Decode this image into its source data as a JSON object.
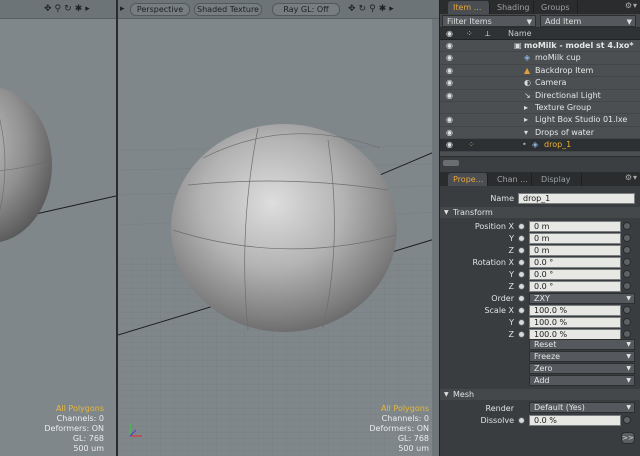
{
  "viewport_left": {
    "icons": [
      "move-icon",
      "zoom-icon",
      "rotate-icon",
      "settings-icon",
      "menu-arrow-icon"
    ],
    "info": {
      "selection_mode": "All Polygons",
      "channels": "Channels: 0",
      "deformers": "Deformers: ON",
      "gl": "GL: 768",
      "units": "500 um"
    }
  },
  "viewport_main": {
    "view_label": "Perspective",
    "shading_label": "Shaded Texture",
    "raygl_label": "Ray GL: Off",
    "info": {
      "selection_mode": "All Polygons",
      "channels": "Channels: 0",
      "deformers": "Deformers: ON",
      "gl": "GL: 768",
      "units": "500 um"
    }
  },
  "item_panel": {
    "tabs": [
      "Item ...",
      "Shading",
      "Groups"
    ],
    "filter_label": "Filter Items",
    "add_label": "Add Item",
    "column_name": "Name",
    "items": [
      {
        "label": "moMilk - model st 4.lxo*",
        "icon": "scene-icon"
      },
      {
        "label": "moMilk cup",
        "icon": "mesh-icon"
      },
      {
        "label": "Backdrop Item",
        "icon": "backdrop-icon"
      },
      {
        "label": "Camera",
        "icon": "camera-icon"
      },
      {
        "label": "Directional Light",
        "icon": "light-icon"
      },
      {
        "label": "Texture Group",
        "icon": "group-icon"
      },
      {
        "label": "Light Box Studio 01.lxe",
        "icon": "group-icon"
      },
      {
        "label": "Drops of water",
        "icon": "group-icon"
      },
      {
        "label": "drop_1",
        "icon": "mesh-icon"
      }
    ]
  },
  "properties_panel": {
    "tabs": [
      "Prope...",
      "Chan ...",
      "Display"
    ],
    "name_label": "Name",
    "name_value": "drop_1",
    "transform_section": "Transform",
    "position": {
      "label": "Position X",
      "values": [
        "0 m",
        "0 m",
        "0 m"
      ]
    },
    "rotation": {
      "label": "Rotation X",
      "values": [
        "0.0 °",
        "0.0 °",
        "0.0 °"
      ]
    },
    "axis_y": "Y",
    "axis_z": "Z",
    "order_label": "Order",
    "order_value": "ZXY",
    "scale": {
      "label": "Scale X",
      "values": [
        "100.0 %",
        "100.0 %",
        "100.0 %"
      ]
    },
    "buttons": [
      "Reset",
      "Freeze",
      "Zero",
      "Add"
    ],
    "mesh_section": "Mesh",
    "render_label": "Render",
    "render_value": "Default (Yes)",
    "dissolve_label": "Dissolve",
    "dissolve_value": "0.0 %",
    "forward_label": ">>"
  },
  "colors": {
    "viewport_bg": "#7f878b",
    "panel_bg": "#3a3d40",
    "accent": "#e8a43a",
    "highlight_text": "#e8b83a",
    "field_bg": "#e7e7e4"
  }
}
